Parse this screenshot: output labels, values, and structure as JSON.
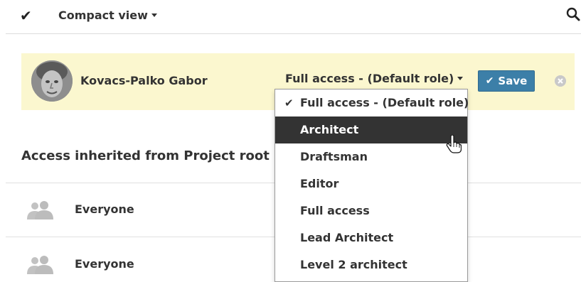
{
  "toolbar": {
    "view_label": "Compact view",
    "check_icon": "checkmark-icon",
    "search_icon": "search-icon"
  },
  "edit_row": {
    "user_name": "Kovacs-Palko Gabor",
    "selected_role": "Full access - (Default role)",
    "save_label": "Save",
    "remove_icon": "close-circle-icon",
    "highlight_color": "#fbf7cf",
    "save_color": "#3c7fa8"
  },
  "inherited": {
    "heading": "Access inherited from Project root",
    "rows": [
      {
        "name": "Everyone",
        "icon": "group-icon"
      },
      {
        "name": "Everyone",
        "icon": "group-icon"
      }
    ]
  },
  "role_menu": {
    "items": [
      {
        "label": "Full access - (Default role)",
        "checked": true
      },
      {
        "label": "Architect",
        "hovered": true
      },
      {
        "label": "Draftsman"
      },
      {
        "label": "Editor"
      },
      {
        "label": "Full access"
      },
      {
        "label": "Lead Architect"
      },
      {
        "label": "Level 2 architect"
      }
    ]
  }
}
